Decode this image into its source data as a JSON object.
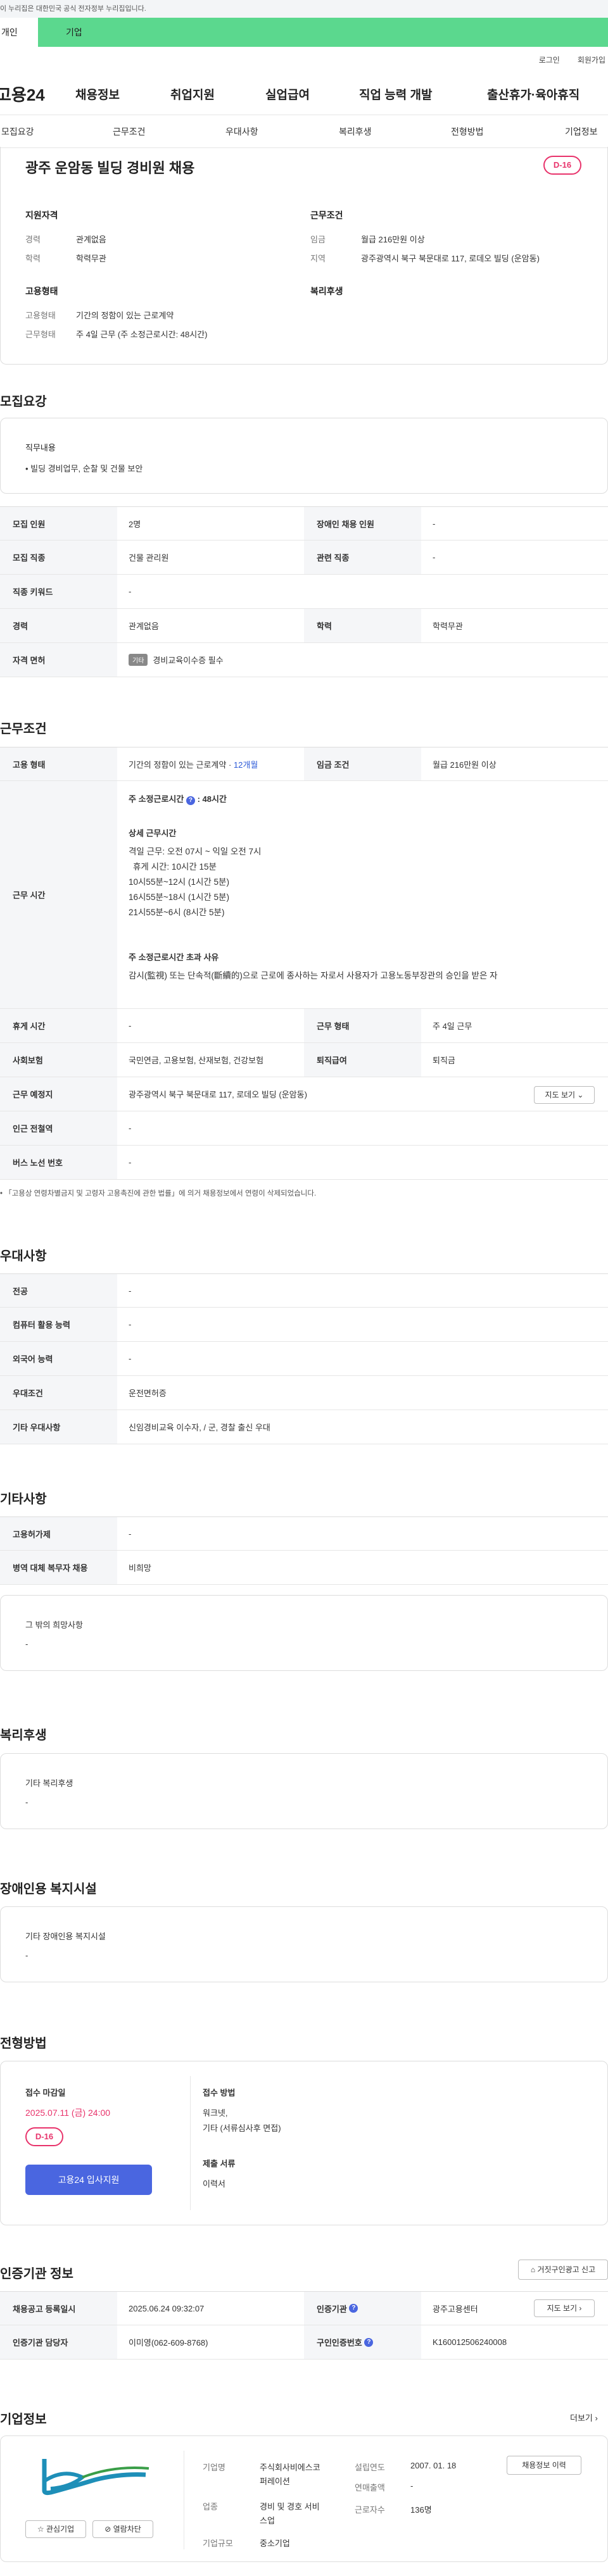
{
  "gov_banner": "이 누리집은 대한민국 공식 전자정부 누리집입니다.",
  "tabs": [
    "개인",
    "기업"
  ],
  "util": [
    "로그인",
    "회원가입"
  ],
  "logo": "고용24",
  "gnb": [
    "채용정보",
    "취업지원",
    "실업급여",
    "직업 능력 개발",
    "출산휴가·육아휴직"
  ],
  "subnav": [
    "모집요강",
    "근무조건",
    "우대사항",
    "복리후생",
    "전형방법",
    "기업정보"
  ],
  "title": "광주 운암동 빌딩 경비원 채용",
  "dday": "D-16",
  "summary": {
    "qual_title": "지원자격",
    "cond_title": "근무조건",
    "emp_title": "고용형태",
    "welfare_title": "복리후생",
    "career_k": "경력",
    "career_v": "관계없음",
    "edu_k": "학력",
    "edu_v": "학력무관",
    "wage_k": "임금",
    "wage_v": "월급 216만원 이상",
    "loc_k": "지역",
    "loc_v": "광주광역시 북구 북문대로 117, 로데오 빌딩 (운암동)",
    "type_k": "고용형태",
    "type_v": "기간의 정함이 있는 근로계약",
    "hours_k": "근무형태",
    "hours_v": "주 4일 근무 (주 소정근로시간: 48시간)"
  },
  "recruit": {
    "section": "모집요강",
    "job_title": "직무내용",
    "job_desc": "• 빌딩 경비업무, 순찰 및 건물 보안",
    "headcount_k": "모집 인원",
    "headcount_v": "2명",
    "disabled_k": "장애인 채용 인원",
    "disabled_v": "-",
    "field_k": "모집 직종",
    "field_v": "건물 관리원",
    "related_k": "관련 직종",
    "related_v": "-",
    "keyword_k": "직종 키워드",
    "keyword_v": "-",
    "career_k": "경력",
    "career_v": "관계없음",
    "edu_k": "학력",
    "edu_v": "학력무관",
    "license_k": "자격 면허",
    "license_badge": "기타",
    "license_v": "경비교육이수증 필수"
  },
  "work": {
    "section": "근무조건",
    "type_k": "고용 형태",
    "type_v": "기간의 정함이 있는 근로계약 · ",
    "type_months": "12개월",
    "wage_k": "임금 조건",
    "wage_v": "월급 216만원 이상",
    "time_k": "근무 시간",
    "weekly_title": "주 소정근로시간",
    "weekly_v": ": 48시간",
    "detail_title": "상세 근무시간",
    "detail": [
      "격일 근무: 오전 07시 ~ 익일 오전 7시",
      "휴게 시간: 10시간 15분",
      "10시55분~12시 (1시간 5분)",
      "16시55분~18시 (1시간 5분)",
      "21시55분~6시 (8시간 5분)"
    ],
    "over_title": "주 소정근로시간 초과 사유",
    "over_v": "감시(監視) 또는 단속적(斷續的)으로 근로에 종사하는 자로서 사용자가 고용노동부장관의 승인을 받은 자",
    "break_k": "휴게 시간",
    "break_v": "-",
    "form_k": "근무 형태",
    "form_v": "주 4일 근무",
    "ins_k": "사회보험",
    "ins_v": "국민연금, 고용보험, 산재보험, 건강보험",
    "retire_k": "퇴직급여",
    "retire_v": "퇴직금",
    "place_k": "근무 예정지",
    "place_v": "광주광역시 북구 북문대로 117, 로데오 빌딩 (운암동)",
    "map_btn": "지도 보기",
    "subway_k": "인근 전철역",
    "subway_v": "-",
    "bus_k": "버스 노선 번호",
    "bus_v": "-",
    "note": "• 「고용상 연령차별금지 및 고령자 고용촉진에 관한 법률」에 의거 채용정보에서 연령이 삭제되었습니다."
  },
  "pref": {
    "section": "우대사항",
    "major_k": "전공",
    "major_v": "-",
    "pc_k": "컴퓨터 활용 능력",
    "pc_v": "-",
    "lang_k": "외국어 능력",
    "lang_v": "-",
    "cond_k": "우대조건",
    "cond_v": "운전면허증",
    "etc_k": "기타 우대사항",
    "etc_v": "신임경비교육 이수자, / 군, 경찰 출신 우대"
  },
  "other": {
    "section": "기타사항",
    "permit_k": "고용허가제",
    "permit_v": "-",
    "military_k": "병역 대체 복무자 채용",
    "military_v": "비희망",
    "wish_title": "그 밖의 희망사항",
    "wish_v": "-"
  },
  "welfare": {
    "section": "복리후생",
    "title": "기타 복리후생",
    "v": "-"
  },
  "facility": {
    "section": "장애인용 복지시설",
    "title": "기타 장애인용 복지시설",
    "v": "-"
  },
  "process": {
    "section": "전형방법",
    "deadline_title": "접수 마감일",
    "deadline_v": "2025.07.11 (금) 24:00",
    "dday": "D-16",
    "apply_btn": "고용24 입사지원",
    "method_title": "접수 방법",
    "method_v": [
      "워크넷,",
      "기타 (서류심사후 면접)"
    ],
    "docs_title": "제출 서류",
    "docs_v": "이력서"
  },
  "cert": {
    "section": "인증기관 정보",
    "report_btn": "거짓구인광고 신고",
    "reg_k": "채용공고 등록일시",
    "reg_v": "2025.06.24 09:32:07",
    "agency_k": "인증기관",
    "agency_v": "광주고용센터",
    "map_btn": "지도 보기",
    "staff_k": "인증기관 담당자",
    "staff_v": "이미영(062-609-8768)",
    "no_k": "구인인증번호",
    "no_v": "K160012506240008"
  },
  "company": {
    "section": "기업정보",
    "more": "더보기",
    "name_k": "기업명",
    "name_v": [
      "주식회사비에스코",
      "퍼레이션"
    ],
    "year_k": "설립연도",
    "year_v": "2007. 01. 18",
    "sales_k": "연매출액",
    "sales_v": "-",
    "biz_k": "업종",
    "biz_v": [
      "경비 및 경호 서비",
      "스업"
    ],
    "emp_k": "근로자수",
    "emp_v": "136명",
    "size_k": "기업규모",
    "size_v": "중소기업",
    "hist_btn": "채용정보 이력",
    "fav_btn": "관심기업",
    "block_btn": "열람차단"
  },
  "colors": {
    "accent": "#5bd88e",
    "dday": "#e8336b",
    "button": "#4a66e0"
  }
}
